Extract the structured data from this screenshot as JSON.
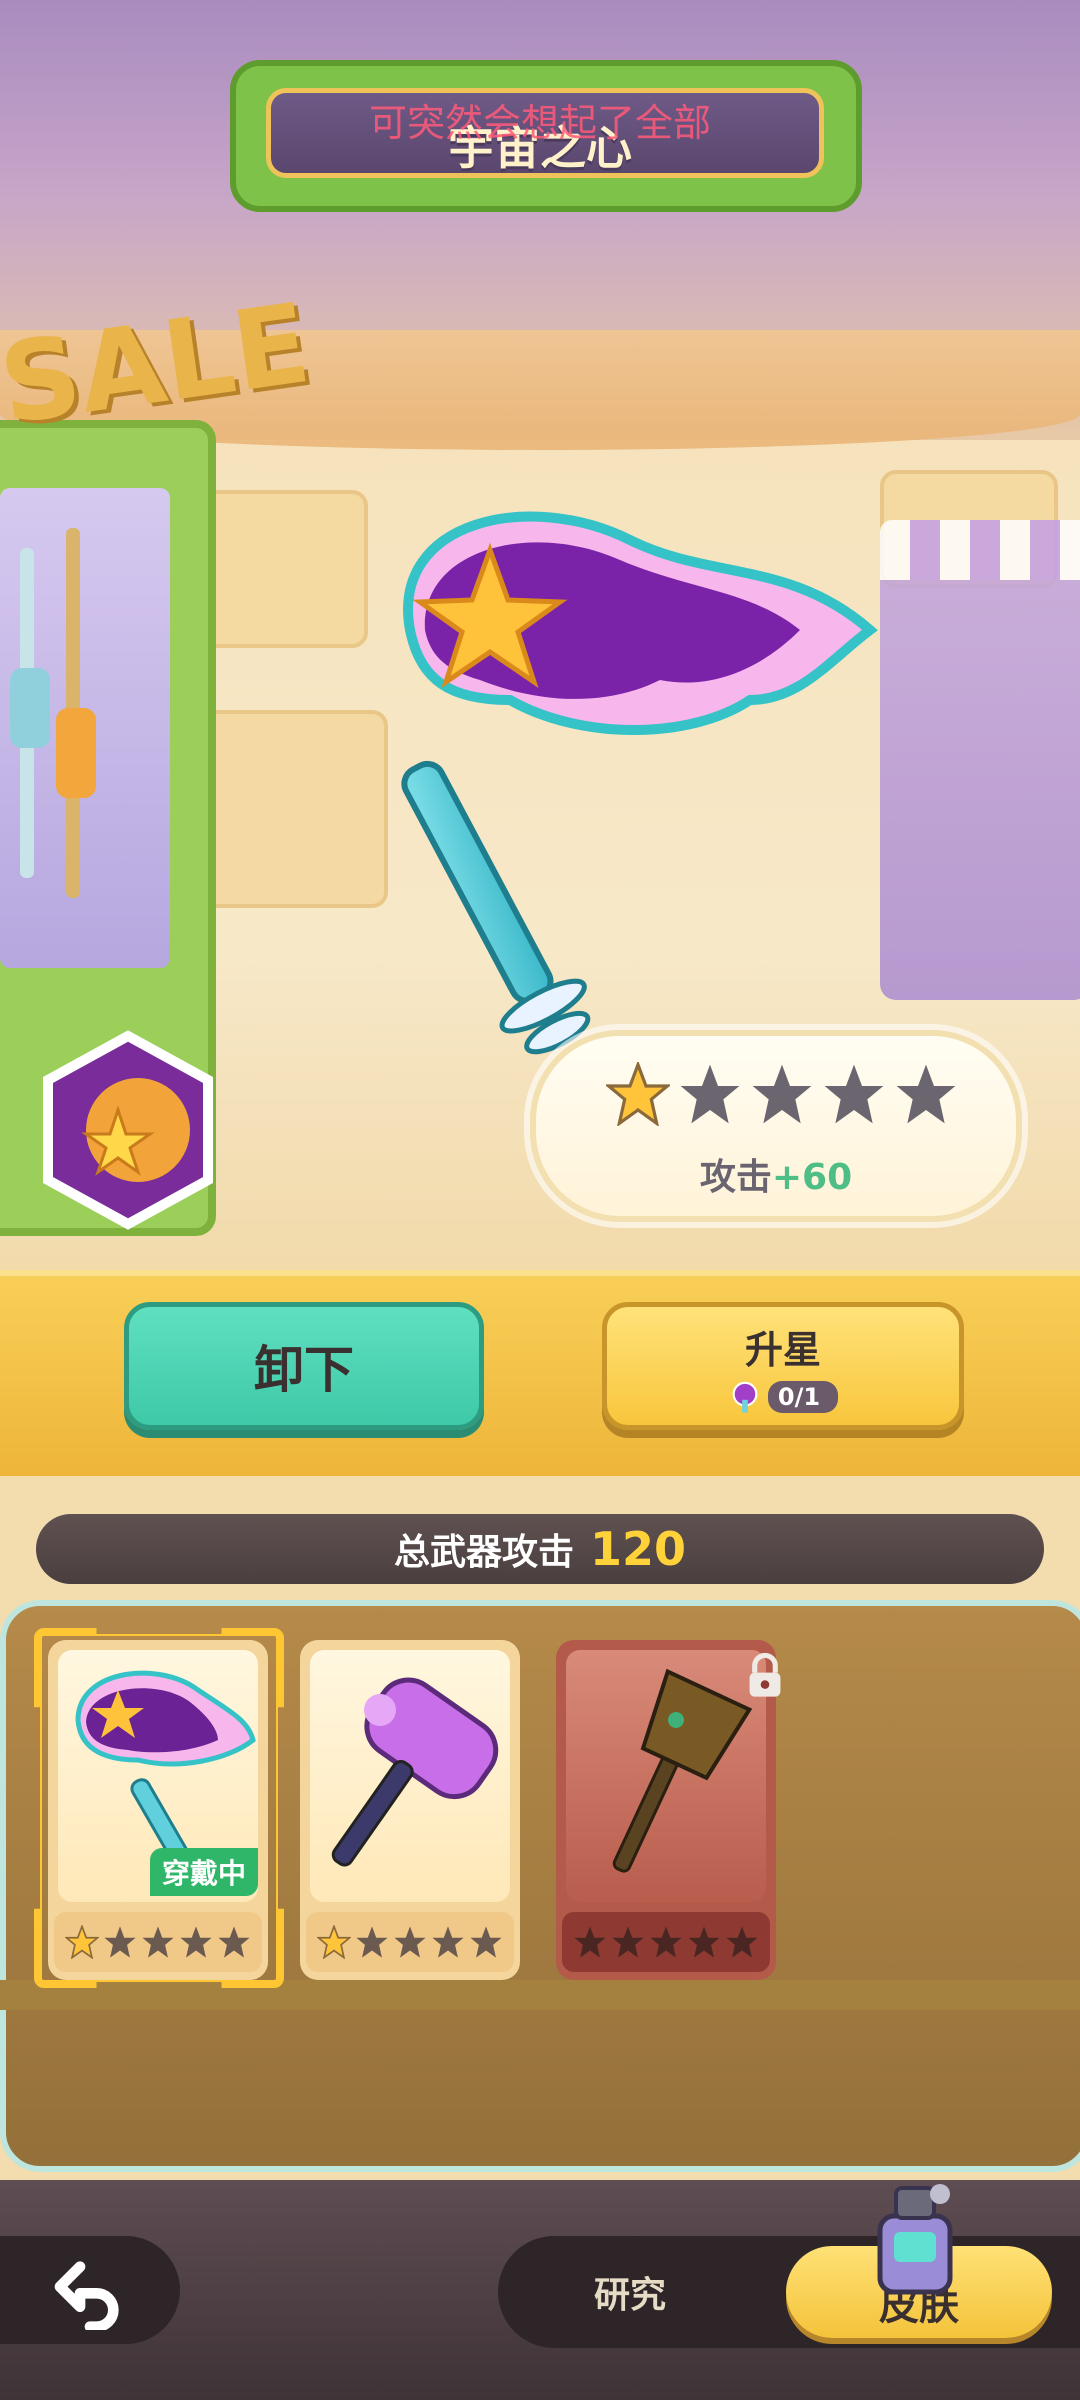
{
  "header": {
    "title": "宇宙之心",
    "overlay_text": "可突然会想起了全部"
  },
  "weapon": {
    "name": "宇宙之心",
    "star_level": 1,
    "max_stars": 5,
    "attack_label": "攻击",
    "attack_bonus": "+60"
  },
  "actions": {
    "unequip_label": "卸下",
    "upgrade_label": "升星",
    "upgrade_cost": "0/1"
  },
  "total_attack": {
    "label": "总武器攻击",
    "value": "120"
  },
  "inventory": [
    {
      "name": "宇宙之心",
      "stars": 1,
      "max_stars": 5,
      "equipped": true,
      "equipped_label": "穿戴中",
      "locked": false
    },
    {
      "name": "purple-hammer",
      "stars": 1,
      "max_stars": 5,
      "equipped": false,
      "locked": false
    },
    {
      "name": "brown-axe",
      "stars": 0,
      "max_stars": 5,
      "equipped": false,
      "locked": true
    }
  ],
  "bottom_nav": {
    "research_label": "研究",
    "skin_label": "皮肤"
  },
  "colors": {
    "teal_button": "#3ec9a7",
    "gold_button": "#f8c63c",
    "attack_bonus": "#4fbd86",
    "total_value": "#ffd23a",
    "equipped_tag": "#2fb668"
  }
}
